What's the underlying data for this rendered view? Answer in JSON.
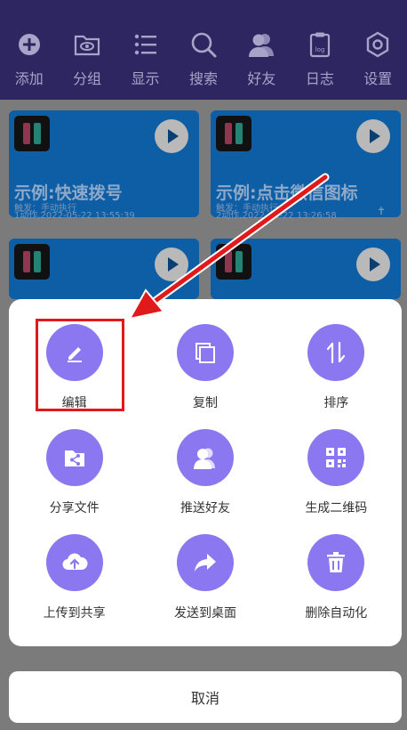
{
  "toolbar": {
    "items": [
      {
        "label": "添加",
        "icon": "plus-circle-icon"
      },
      {
        "label": "分组",
        "icon": "folder-eye-icon"
      },
      {
        "label": "显示",
        "icon": "list-icon"
      },
      {
        "label": "搜索",
        "icon": "search-icon"
      },
      {
        "label": "好友",
        "icon": "friends-icon"
      },
      {
        "label": "日志",
        "icon": "log-icon"
      },
      {
        "label": "设置",
        "icon": "gear-hexagon-icon"
      }
    ]
  },
  "cards": [
    {
      "title": "示例:快速拨号",
      "trigger": "触发：手动执行",
      "meta": "1动作,2022-05-22 13:55:39"
    },
    {
      "title": "示例:点击微信图标",
      "trigger": "触发：手动执行",
      "meta": "2动作,2022-05-22 13:26:58"
    }
  ],
  "sheet": {
    "actions": [
      {
        "label": "编辑",
        "icon": "edit-pencil-icon"
      },
      {
        "label": "复制",
        "icon": "copy-icon"
      },
      {
        "label": "排序",
        "icon": "sort-icon"
      },
      {
        "label": "分享文件",
        "icon": "share-file-icon"
      },
      {
        "label": "推送好友",
        "icon": "push-friend-icon"
      },
      {
        "label": "生成二维码",
        "icon": "qr-code-icon"
      },
      {
        "label": "上传到共享",
        "icon": "cloud-upload-icon"
      },
      {
        "label": "发送到桌面",
        "icon": "send-forward-icon"
      },
      {
        "label": "删除自动化",
        "icon": "trash-icon"
      }
    ],
    "cancel_label": "取消"
  },
  "colors": {
    "toolbar_bg": "#2e2660",
    "action_circle": "#8b77f0",
    "card_bg": "#0e5ea6",
    "highlight": "#e01a1a"
  }
}
